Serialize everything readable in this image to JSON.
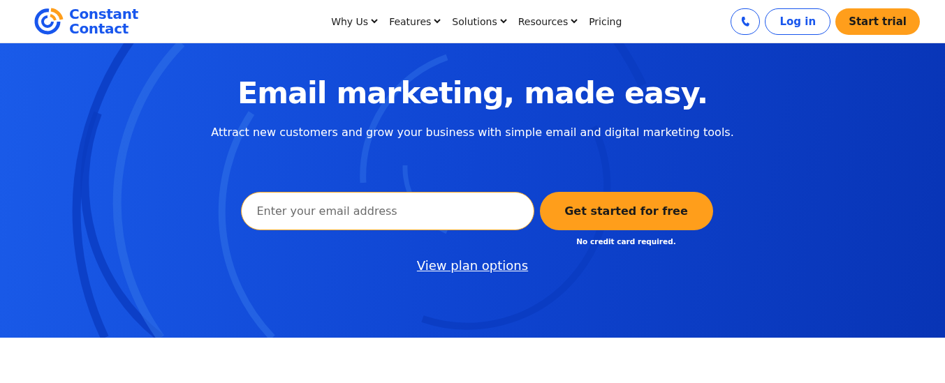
{
  "header": {
    "logo": {
      "lines": [
        "Constant",
        "Contact"
      ]
    },
    "nav": [
      {
        "label": "Why Us",
        "has_menu": true
      },
      {
        "label": "Features",
        "has_menu": true
      },
      {
        "label": "Solutions",
        "has_menu": true
      },
      {
        "label": "Resources",
        "has_menu": true
      },
      {
        "label": "Pricing",
        "has_menu": false
      }
    ],
    "login": "Log in",
    "trial": "Start trial"
  },
  "hero": {
    "title": "Email marketing, made easy.",
    "subtitle": "Attract new customers and grow your business with simple email and digital marketing tools.",
    "email": {
      "placeholder": "Enter your email address"
    },
    "cta": "Get started for free",
    "note": "No credit card required.",
    "link": "View plan options"
  }
}
